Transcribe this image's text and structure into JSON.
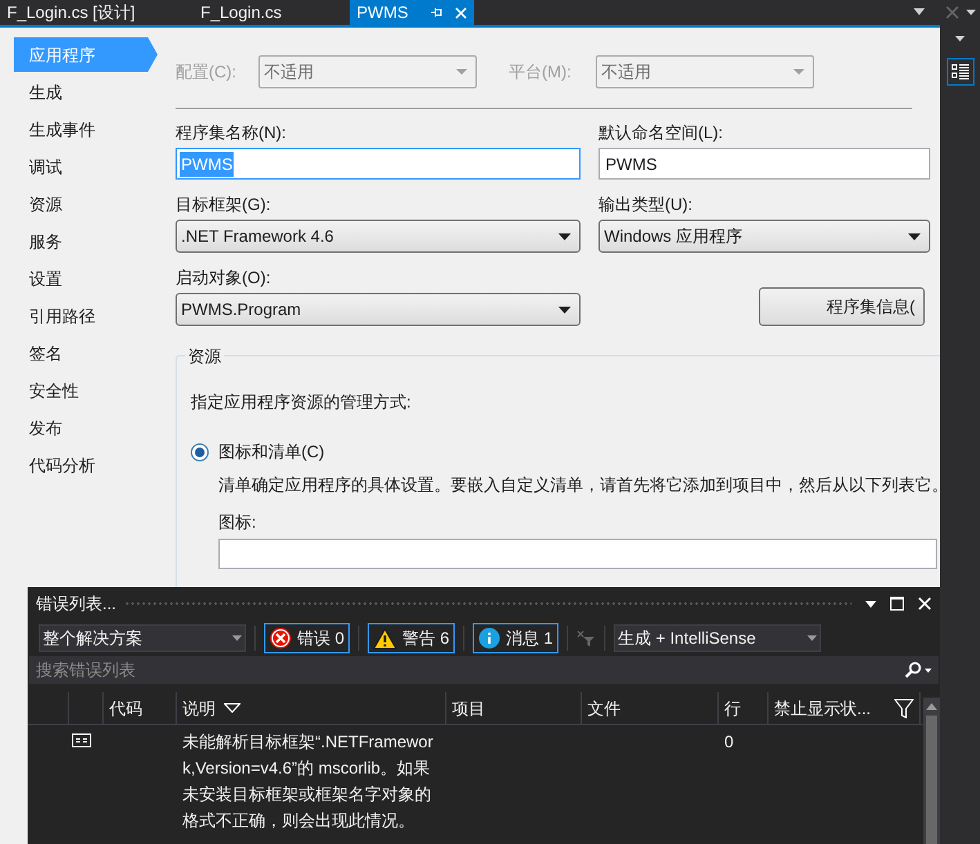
{
  "tabs": [
    {
      "label": "F_Login.cs [设计]",
      "selected": false
    },
    {
      "label": "F_Login.cs",
      "selected": false
    },
    {
      "label": "PWMS",
      "selected": true
    }
  ],
  "nav": {
    "items": [
      {
        "label": "应用程序",
        "selected": true
      },
      {
        "label": "生成",
        "selected": false
      },
      {
        "label": "生成事件",
        "selected": false
      },
      {
        "label": "调试",
        "selected": false
      },
      {
        "label": "资源",
        "selected": false
      },
      {
        "label": "服务",
        "selected": false
      },
      {
        "label": "设置",
        "selected": false
      },
      {
        "label": "引用路径",
        "selected": false
      },
      {
        "label": "签名",
        "selected": false
      },
      {
        "label": "安全性",
        "selected": false
      },
      {
        "label": "发布",
        "selected": false
      },
      {
        "label": "代码分析",
        "selected": false
      }
    ]
  },
  "config": {
    "disabled": true,
    "configuration_label": "配置(C):",
    "configuration_value": "不适用",
    "platform_label": "平台(M):",
    "platform_value": "不适用"
  },
  "assembly_name": {
    "label": "程序集名称(N):",
    "value": "PWMS"
  },
  "default_namespace": {
    "label": "默认命名空间(L):",
    "value": "PWMS"
  },
  "target_framework": {
    "label": "目标框架(G):",
    "value": ".NET Framework 4.6"
  },
  "output_type": {
    "label": "输出类型(U):",
    "value": "Windows 应用程序"
  },
  "startup_object": {
    "label": "启动对象(O):",
    "value": "PWMS.Program"
  },
  "assembly_info_button": "程序集信息(",
  "resources": {
    "legend": "资源",
    "prompt": "指定应用程序资源的管理方式:",
    "option": {
      "label": "图标和清单(C)",
      "selected": true
    },
    "description": "清单确定应用程序的具体设置。要嵌入自定义清单，请首先将它添加到项目中，然后从以下列表它。",
    "icon_label": "图标:"
  },
  "error_list": {
    "title": "错误列表...",
    "scope": "整个解决方案",
    "filters": [
      {
        "kind": "error",
        "label": "错误 0",
        "selected": true
      },
      {
        "kind": "warning",
        "label": "警告 6",
        "selected": true
      },
      {
        "kind": "info",
        "label": "消息 1",
        "selected": true
      }
    ],
    "source": "生成 + IntelliSense",
    "search": {
      "placeholder": "搜索错误列表"
    },
    "columns": [
      "代码",
      "说明",
      "项目",
      "文件",
      "行",
      "禁止显示状..."
    ],
    "rows": [
      {
        "code": "",
        "description": "未能解析目标框架“.NETFramework,Version=v4.6”的 mscorlib。如果未安装目标框架或框架名字对象的格式不正确，则会出现此情况。",
        "project": "",
        "file": "",
        "line": "0"
      }
    ]
  }
}
